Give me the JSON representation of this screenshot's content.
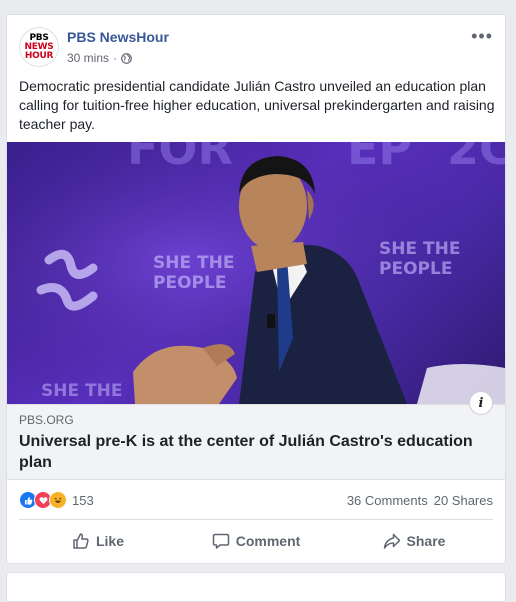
{
  "post": {
    "page_name": "PBS NewsHour",
    "avatar": {
      "line1": "PBS",
      "line2": "NEWS",
      "line3": "HOUR"
    },
    "time": "30 mins",
    "separator": "·",
    "more_label": "•••",
    "text": "Democratic presidential candidate Julián Castro unveiled an education plan calling for tuition-free higher education, universal prekindergarten and raising teacher pay."
  },
  "photo": {
    "background_text": [
      "SHE THE",
      "PEOPLE"
    ]
  },
  "link": {
    "domain": "PBS.ORG",
    "title": "Universal pre-K is at the center of Julián Castro's education plan",
    "info_label": "i"
  },
  "stats": {
    "reaction_count": "153",
    "comments": "36 Comments",
    "shares": "20 Shares",
    "reactions": [
      "like",
      "love",
      "haha"
    ]
  },
  "actions": {
    "like": "Like",
    "comment": "Comment",
    "share": "Share"
  },
  "colors": {
    "page_name": "#385898",
    "like": "#1877f2",
    "love": "#f33e58",
    "haha": "#f7b125"
  }
}
